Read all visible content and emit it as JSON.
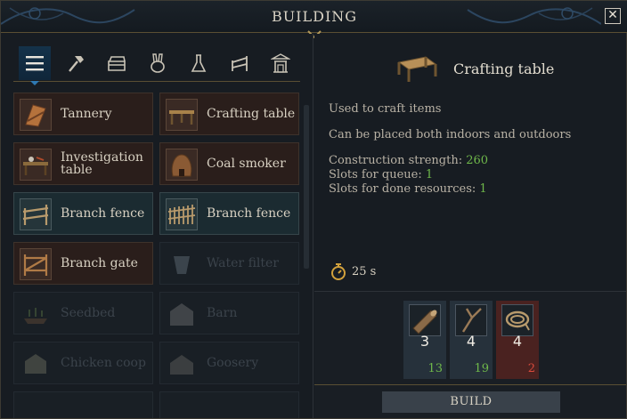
{
  "window": {
    "title": "BUILDING"
  },
  "tabs": [
    {
      "icon": "list-icon",
      "active": true
    },
    {
      "icon": "hammer-icon",
      "active": false
    },
    {
      "icon": "chest-icon",
      "active": false
    },
    {
      "icon": "rabbit-icon",
      "active": false
    },
    {
      "icon": "flask-icon",
      "active": false
    },
    {
      "icon": "fence-icon",
      "active": false
    },
    {
      "icon": "shrine-icon",
      "active": false
    }
  ],
  "buildings": [
    {
      "label": "Tannery",
      "state": "available"
    },
    {
      "label": "Crafting table",
      "state": "selected"
    },
    {
      "label": "Investigation table",
      "state": "available"
    },
    {
      "label": "Coal smoker",
      "state": "available"
    },
    {
      "label": "Branch fence",
      "state": "upgrade"
    },
    {
      "label": "Branch fence",
      "state": "upgrade"
    },
    {
      "label": "Branch gate",
      "state": "available"
    },
    {
      "label": "Water filter",
      "state": "locked"
    },
    {
      "label": "Seedbed",
      "state": "locked"
    },
    {
      "label": "Barn",
      "state": "locked"
    },
    {
      "label": "Chicken coop",
      "state": "locked"
    },
    {
      "label": "Goosery",
      "state": "locked"
    }
  ],
  "details": {
    "name": "Crafting table",
    "description_1": "Used to craft items",
    "description_2": "Can be placed both indoors and outdoors",
    "construction_strength_label": "Construction strength:",
    "construction_strength": "260",
    "queue_slots_label": "Slots for queue:",
    "queue_slots": "1",
    "done_slots_label": "Slots for done resources:",
    "done_slots": "1",
    "time": "25 s"
  },
  "resources": [
    {
      "icon": "log-icon",
      "required": "3",
      "available": "13",
      "sufficient": true
    },
    {
      "icon": "branch-icon",
      "required": "4",
      "available": "19",
      "sufficient": true
    },
    {
      "icon": "rope-icon",
      "required": "4",
      "available": "2",
      "sufficient": false
    }
  ],
  "build_button": "BUILD",
  "colors": {
    "accent_gold": "#5a4f33",
    "sufficient_green": "#6fb84a",
    "insufficient_red": "#d84a3c",
    "active_tab_blue": "#2e79b2"
  }
}
